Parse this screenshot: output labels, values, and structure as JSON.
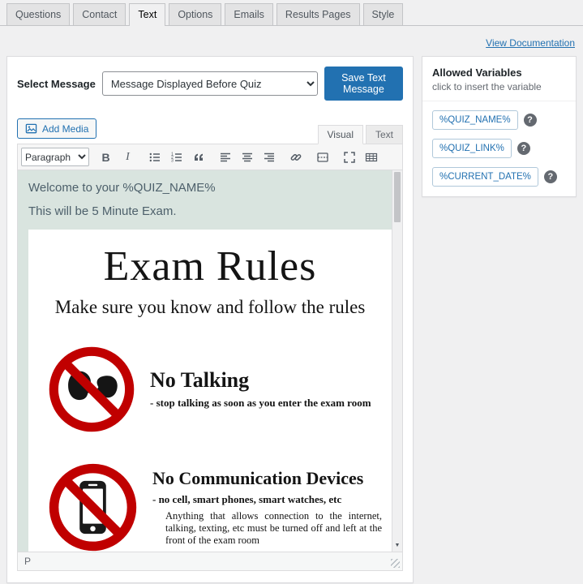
{
  "nav_tabs": [
    {
      "label": "Questions",
      "active": false
    },
    {
      "label": "Contact",
      "active": false
    },
    {
      "label": "Text",
      "active": true
    },
    {
      "label": "Options",
      "active": false
    },
    {
      "label": "Emails",
      "active": false
    },
    {
      "label": "Results Pages",
      "active": false
    },
    {
      "label": "Style",
      "active": false
    }
  ],
  "header": {
    "documentation_link": "View Documentation"
  },
  "message_panel": {
    "select_label": "Select Message",
    "selected_message": "Message Displayed Before Quiz",
    "save_button": "Save Text Message"
  },
  "editor": {
    "add_media_button": "Add Media",
    "mode_tabs": [
      {
        "label": "Visual",
        "active": true
      },
      {
        "label": "Text",
        "active": false
      }
    ],
    "paragraph_dropdown": "Paragraph",
    "content_lines": [
      "Welcome to your %QUIZ_NAME%",
      "This will be 5 Minute Exam."
    ],
    "status_path": "P"
  },
  "poster": {
    "title": "Exam Rules",
    "subtitle": "Make sure you know and follow the rules",
    "rules": [
      {
        "heading": "No Talking",
        "subheading": "- stop talking as soon as you enter the exam room"
      },
      {
        "heading": "No Communication Devices",
        "subheading": "- no cell, smart phones, smart watches, etc",
        "detail": "Anything that allows connection to the internet, talking, texting, etc must be turned off and left at the front of the exam room"
      }
    ]
  },
  "sidebar": {
    "title": "Allowed Variables",
    "subtitle": "click to insert the variable",
    "variables": [
      "%QUIZ_NAME%",
      "%QUIZ_LINK%",
      "%CURRENT_DATE%"
    ],
    "help_glyph": "?"
  },
  "icons": {
    "bold": "B",
    "italic": "I",
    "scroll_down": "▼"
  },
  "colors": {
    "accent": "#2271b1",
    "editor_background": "#d9e4df",
    "prohibition_red": "#c00000"
  }
}
